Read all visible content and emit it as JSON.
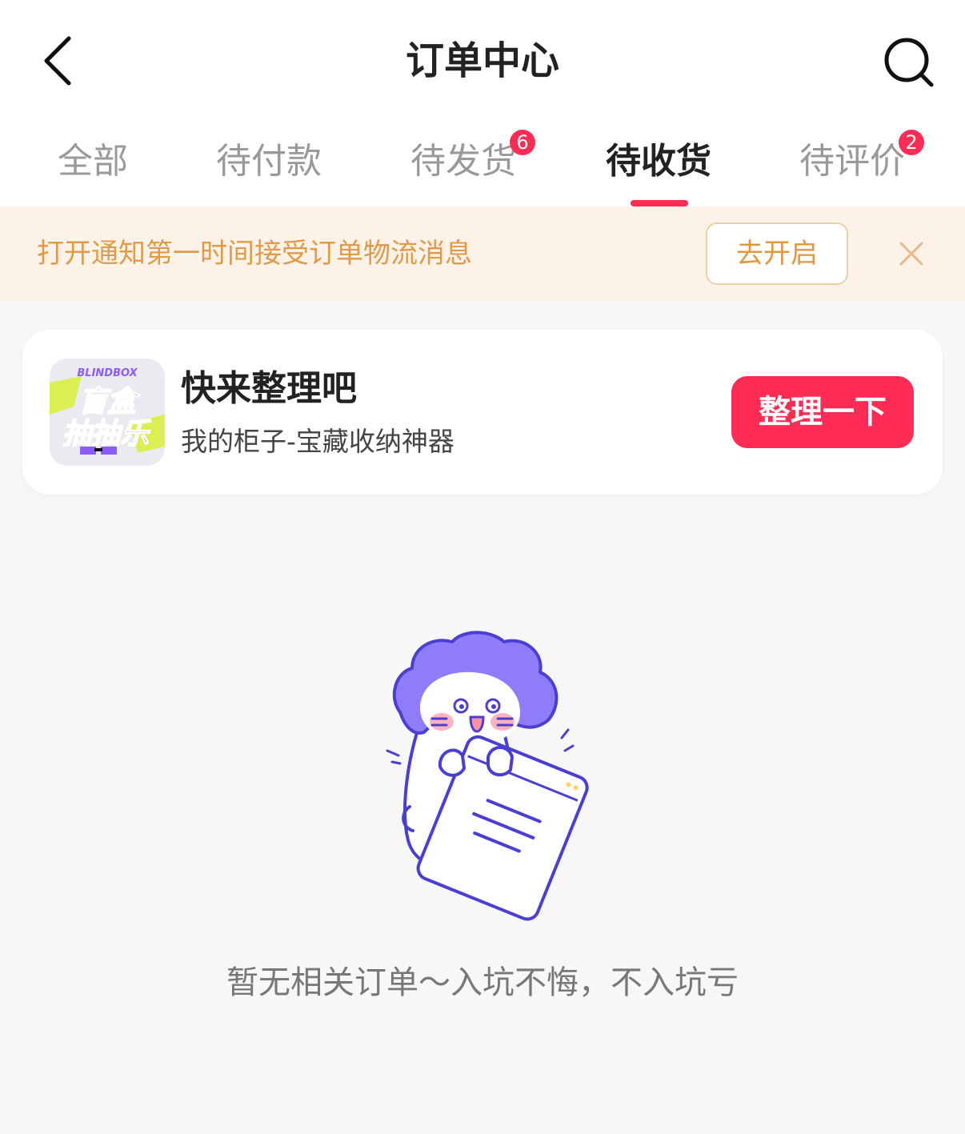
{
  "header": {
    "title": "订单中心"
  },
  "tabs": [
    {
      "label": "全部",
      "badge": ""
    },
    {
      "label": "待付款",
      "badge": ""
    },
    {
      "label": "待发货",
      "badge": "6"
    },
    {
      "label": "待收货",
      "badge": ""
    },
    {
      "label": "待评价",
      "badge": "2"
    }
  ],
  "active_tab": "待收货",
  "notice": {
    "text": "打开通知第一时间接受订单物流消息",
    "button_label": "去开启"
  },
  "promo": {
    "icon_text_top": "BLINDBOX",
    "icon_text_line1": "盲盒",
    "icon_text_line2": "抽抽乐",
    "title": "快来整理吧",
    "subtitle": "我的柜子-宝藏收纳神器",
    "button_label": "整理一下"
  },
  "empty_state": {
    "message": "暂无相关订单～入坑不悔，不入坑亏"
  },
  "colors": {
    "accent": "#ff2d55",
    "notice_bg": "#fdf2e7",
    "notice_text": "#e09b4a",
    "mascot_hair": "#8f7cf8",
    "mascot_line": "#4a3fcf"
  }
}
